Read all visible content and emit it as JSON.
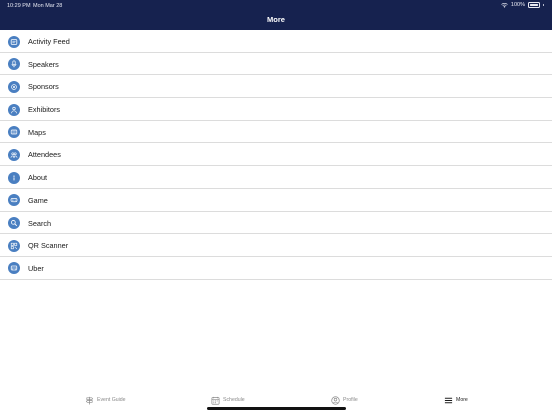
{
  "status_bar": {
    "time": "10:29 PM",
    "date": "Mon Mar 28",
    "battery": "100%"
  },
  "nav": {
    "title": "More"
  },
  "menu": {
    "items": [
      {
        "label": "Activity Feed",
        "icon": "feed-icon"
      },
      {
        "label": "Speakers",
        "icon": "speakers-icon"
      },
      {
        "label": "Sponsors",
        "icon": "sponsors-icon"
      },
      {
        "label": "Exhibitors",
        "icon": "exhibitors-icon"
      },
      {
        "label": "Maps",
        "icon": "map-icon"
      },
      {
        "label": "Attendees",
        "icon": "attendees-icon"
      },
      {
        "label": "About",
        "icon": "info-icon"
      },
      {
        "label": "Game",
        "icon": "game-icon"
      },
      {
        "label": "Search",
        "icon": "search-icon"
      },
      {
        "label": "QR Scanner",
        "icon": "qr-code-icon"
      },
      {
        "label": "Uber",
        "icon": "car-icon"
      }
    ]
  },
  "tabs": {
    "items": [
      {
        "label": "Event Guide",
        "icon": "signpost-icon"
      },
      {
        "label": "Schedule",
        "icon": "calendar-icon"
      },
      {
        "label": "Profile",
        "icon": "profile-icon"
      },
      {
        "label": "More",
        "icon": "hamburger-menu-icon",
        "active": true
      }
    ]
  },
  "colors": {
    "header_bg": "#16224f",
    "icon_circle": "#4a7fc1",
    "divider": "#dcdcdc"
  }
}
